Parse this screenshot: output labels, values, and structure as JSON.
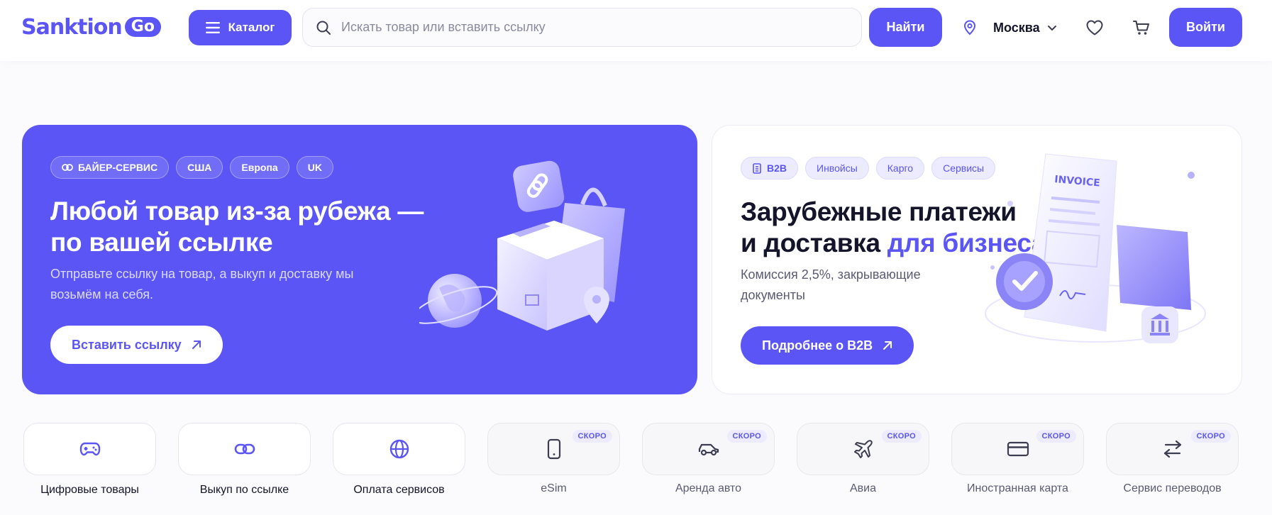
{
  "header": {
    "logo_text": "Sanktion",
    "logo_badge": "Go",
    "catalog_label": "Каталог",
    "search_placeholder": "Искать товар или вставить ссылку",
    "find_label": "Найти",
    "city": "Москва",
    "login_label": "Войти"
  },
  "hero_left": {
    "chips": [
      "БАЙЕР-СЕРВИС",
      "США",
      "Европа",
      "UK"
    ],
    "title_line1": "Любой товар из-за рубежа —",
    "title_line2": "по вашей ссылке",
    "subtitle": "Отправьте ссылку на товар, а выкуп и доставку мы возьмём на себя.",
    "cta_label": "Вставить ссылку"
  },
  "hero_right": {
    "chips": [
      "B2B",
      "Инвойсы",
      "Карго",
      "Сервисы"
    ],
    "title_line1": "Зарубежные платежи",
    "title_line2_plain": "и доставка ",
    "title_line2_accent": "для бизнеса",
    "subtitle": "Комиссия 2,5%, закрывающие документы",
    "cta_label": "Подробнее о B2B",
    "invoice_text": "INVOICE"
  },
  "services": [
    {
      "label": "Цифровые товары",
      "icon": "gamepad-icon",
      "soon": false
    },
    {
      "label": "Выкуп по ссылке",
      "icon": "link-icon",
      "soon": false
    },
    {
      "label": "Оплата сервисов",
      "icon": "globe-icon",
      "soon": false
    },
    {
      "label": "eSim",
      "icon": "phone-icon",
      "soon": true
    },
    {
      "label": "Аренда авто",
      "icon": "car-icon",
      "soon": true
    },
    {
      "label": "Авиа",
      "icon": "plane-icon",
      "soon": true
    },
    {
      "label": "Иностранная карта",
      "icon": "card-icon",
      "soon": true
    },
    {
      "label": "Сервис переводов",
      "icon": "transfer-icon",
      "soon": true
    }
  ],
  "soon_badge": "СКОРО",
  "colors": {
    "accent": "#5b55f5",
    "text": "#14142b",
    "muted": "#5a5a72"
  }
}
